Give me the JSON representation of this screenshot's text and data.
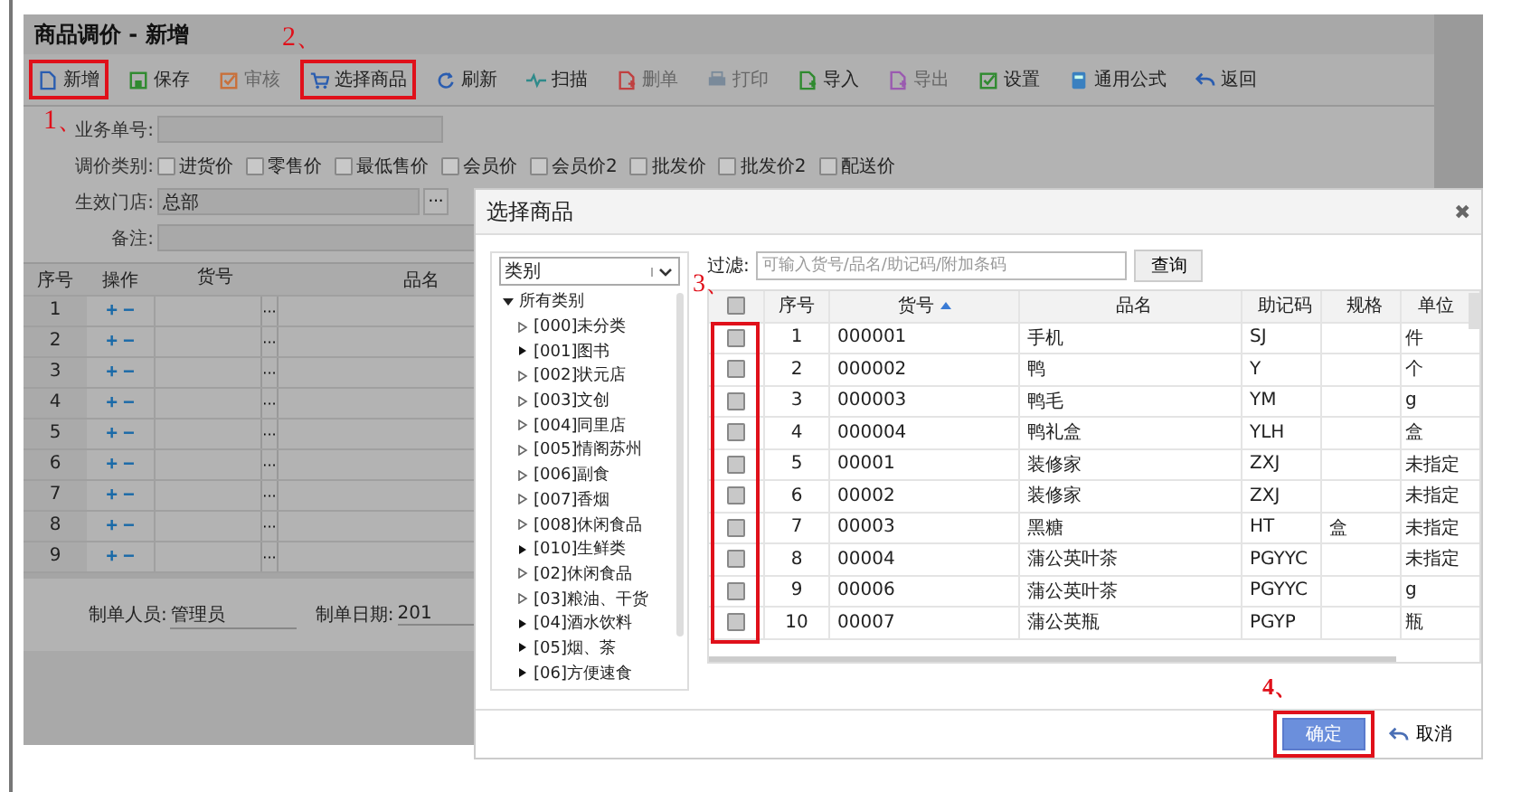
{
  "window": {
    "title": "商品调价 - 新增"
  },
  "toolbar": [
    {
      "label": "新增",
      "disabled": false,
      "highlighted": true,
      "annotation": "1、"
    },
    {
      "label": "保存",
      "disabled": false,
      "highlighted": false
    },
    {
      "label": "审核",
      "disabled": true,
      "highlighted": false
    },
    {
      "label": "选择商品",
      "disabled": false,
      "highlighted": true,
      "annotation": "2、"
    },
    {
      "label": "刷新",
      "disabled": false,
      "highlighted": false
    },
    {
      "label": "扫描",
      "disabled": false,
      "highlighted": false
    },
    {
      "label": "删单",
      "disabled": true,
      "highlighted": false
    },
    {
      "label": "打印",
      "disabled": true,
      "highlighted": false
    },
    {
      "label": "导入",
      "disabled": false,
      "highlighted": false
    },
    {
      "label": "导出",
      "disabled": true,
      "highlighted": false
    },
    {
      "label": "设置",
      "disabled": false,
      "highlighted": false
    },
    {
      "label": "通用公式",
      "disabled": false,
      "highlighted": false
    },
    {
      "label": "返回",
      "disabled": false,
      "highlighted": false
    }
  ],
  "form": {
    "order_no": {
      "label": "业务单号:"
    },
    "price_types": {
      "label": "调价类别:",
      "options": [
        {
          "label": "进货价",
          "checked": false
        },
        {
          "label": "零售价",
          "checked": false
        },
        {
          "label": "最低售价",
          "checked": false
        },
        {
          "label": "会员价",
          "checked": false
        },
        {
          "label": "会员价2",
          "checked": false
        },
        {
          "label": "批发价",
          "checked": false
        },
        {
          "label": "批发价2",
          "checked": false
        },
        {
          "label": "配送价",
          "checked": false
        }
      ]
    },
    "store": {
      "label": "生效门店:",
      "value": "总部",
      "button": "···"
    },
    "remark": {
      "label": "备注:"
    }
  },
  "table": {
    "columns": [
      "序号",
      "操作",
      "货号",
      "品名"
    ],
    "rows": [
      "1",
      "2",
      "3",
      "4",
      "5",
      "6",
      "7",
      "8",
      "9"
    ],
    "plus": "+",
    "minus": "−",
    "picker": "···"
  },
  "footer": {
    "creator_label": "制单人员:",
    "creator": "管理员",
    "date_label": "制单日期:",
    "date": "201"
  },
  "dialog": {
    "title": "选择商品",
    "close": "✖",
    "category_select": "类别",
    "tree": {
      "label": "所有类别",
      "expanded": true,
      "children": [
        {
          "label": "[000]未分类",
          "kind": "leaf"
        },
        {
          "label": "[001]图书",
          "kind": "branch"
        },
        {
          "label": "[002]状元店",
          "kind": "leaf"
        },
        {
          "label": "[003]文创",
          "kind": "leaf"
        },
        {
          "label": "[004]同里店",
          "kind": "leaf"
        },
        {
          "label": "[005]情阁苏州",
          "kind": "leaf"
        },
        {
          "label": "[006]副食",
          "kind": "leaf"
        },
        {
          "label": "[007]香烟",
          "kind": "leaf"
        },
        {
          "label": "[008]休闲食品",
          "kind": "leaf"
        },
        {
          "label": "[010]生鲜类",
          "kind": "branch"
        },
        {
          "label": "[02]休闲食品",
          "kind": "leaf"
        },
        {
          "label": "[03]粮油、干货",
          "kind": "leaf"
        },
        {
          "label": "[04]酒水饮料",
          "kind": "branch"
        },
        {
          "label": "[05]烟、茶",
          "kind": "branch"
        },
        {
          "label": "[06]方便速食",
          "kind": "branch"
        }
      ]
    },
    "filter": {
      "label": "过滤:",
      "placeholder": "可输入货号/品名/助记码/附加条码",
      "button": "查询"
    },
    "grid": {
      "columns": [
        "序号",
        "货号",
        "品名",
        "助记码",
        "规格",
        "单位"
      ],
      "annotation": "3、",
      "header_checked": false,
      "rows": [
        {
          "checked": false,
          "cells": [
            "1",
            "000001",
            "手机",
            "SJ",
            "",
            "件"
          ]
        },
        {
          "checked": false,
          "cells": [
            "2",
            "000002",
            "鸭",
            "Y",
            "",
            "个"
          ]
        },
        {
          "checked": false,
          "cells": [
            "3",
            "000003",
            "鸭毛",
            "YM",
            "",
            "g"
          ]
        },
        {
          "checked": false,
          "cells": [
            "4",
            "000004",
            "鸭礼盒",
            "YLH",
            "",
            "盒"
          ]
        },
        {
          "checked": false,
          "cells": [
            "5",
            "00001",
            "装修家",
            "ZXJ",
            "",
            "未指定"
          ]
        },
        {
          "checked": false,
          "cells": [
            "6",
            "00002",
            "装修家",
            "ZXJ",
            "",
            "未指定"
          ]
        },
        {
          "checked": false,
          "cells": [
            "7",
            "00003",
            "黑糖",
            "HT",
            "盒",
            "未指定"
          ]
        },
        {
          "checked": false,
          "cells": [
            "8",
            "00004",
            "蒲公英叶茶",
            "PGYYC",
            "",
            "未指定"
          ]
        },
        {
          "checked": false,
          "cells": [
            "9",
            "00006",
            "蒲公英叶茶",
            "PGYYC",
            "",
            "g"
          ]
        },
        {
          "checked": false,
          "cells": [
            "10",
            "00007",
            "蒲公英瓶",
            "PGYP",
            "",
            "瓶"
          ]
        }
      ]
    },
    "ok": {
      "label": "确定",
      "annotation": "4、"
    },
    "cancel": "取消"
  }
}
